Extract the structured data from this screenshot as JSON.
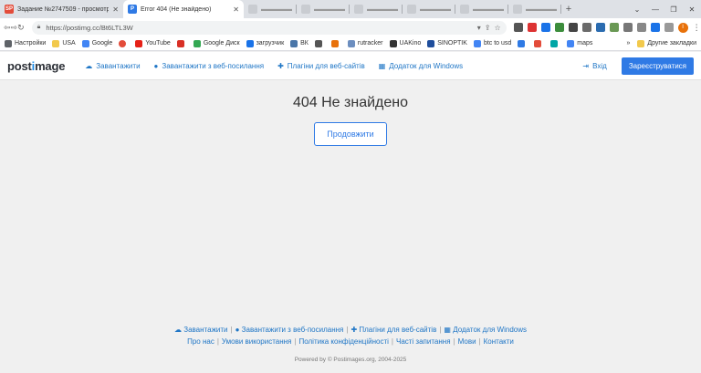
{
  "browser": {
    "tabs": [
      {
        "label": "Задание №2747509 - просмотр з",
        "favicon_text": "SP",
        "favicon_color": "#e34c3a"
      },
      {
        "label": "Error 404 (Не знайдено)",
        "favicon_text": "P",
        "favicon_color": "#2f7ae5"
      }
    ],
    "url": "https://postimg.cc/Bt6LTL3W",
    "bookmarks": [
      {
        "label": "Настройки",
        "color": "#5f6368"
      },
      {
        "label": "USA",
        "color": "#f2c94c"
      },
      {
        "label": "Google",
        "color": "#4285f4"
      },
      {
        "label": "",
        "color": "#e34c3a"
      },
      {
        "label": "YouTube",
        "color": "#e62117"
      },
      {
        "label": "",
        "color": "#d93025"
      },
      {
        "label": "Google Диск",
        "color": "#34a853"
      },
      {
        "label": "загрузчик",
        "color": "#1a73e8"
      },
      {
        "label": "ВК",
        "color": "#4a76a8"
      },
      {
        "label": "",
        "color": "#555555"
      },
      {
        "label": "",
        "color": "#e8710a"
      },
      {
        "label": "rutracker",
        "color": "#6c8ebf"
      },
      {
        "label": "UAKino",
        "color": "#333333"
      },
      {
        "label": "SINOPTIK",
        "color": "#1f4e9c"
      },
      {
        "label": "btc to usd",
        "color": "#4285f4"
      },
      {
        "label": "",
        "color": "#2f7ae5"
      },
      {
        "label": "",
        "color": "#e34c3a"
      },
      {
        "label": "",
        "color": "#00a6a6"
      },
      {
        "label": "maps",
        "color": "#4285f4"
      }
    ],
    "bookmarks_more": "»",
    "other_bookmarks": "Другие закладки"
  },
  "site": {
    "logo_prefix": "post",
    "logo_o": "i",
    "logo_suffix": "mage",
    "nav": [
      {
        "label": "Завантажити",
        "icon": "cloud-upload-icon"
      },
      {
        "label": "Завантажити з веб-посилання",
        "icon": "globe-icon"
      },
      {
        "label": "Плагіни для веб-сайтів",
        "icon": "puzzle-icon"
      },
      {
        "label": "Додаток для Windows",
        "icon": "windows-icon"
      }
    ],
    "login": "Вхід",
    "register": "Зареєструватися"
  },
  "main": {
    "heading": "404 Не знайдено",
    "continue": "Продовжити"
  },
  "footer": {
    "row1": [
      "Завантажити",
      "Завантажити з веб-посилання",
      "Плагіни для веб-сайтів",
      "Додаток для Windows"
    ],
    "row2": [
      "Про нас",
      "Умови використання",
      "Політика конфіденційності",
      "Часті запитання",
      "Мови",
      "Контакти"
    ],
    "copyright": "Powered by © Postimages.org, 2004-2025"
  }
}
